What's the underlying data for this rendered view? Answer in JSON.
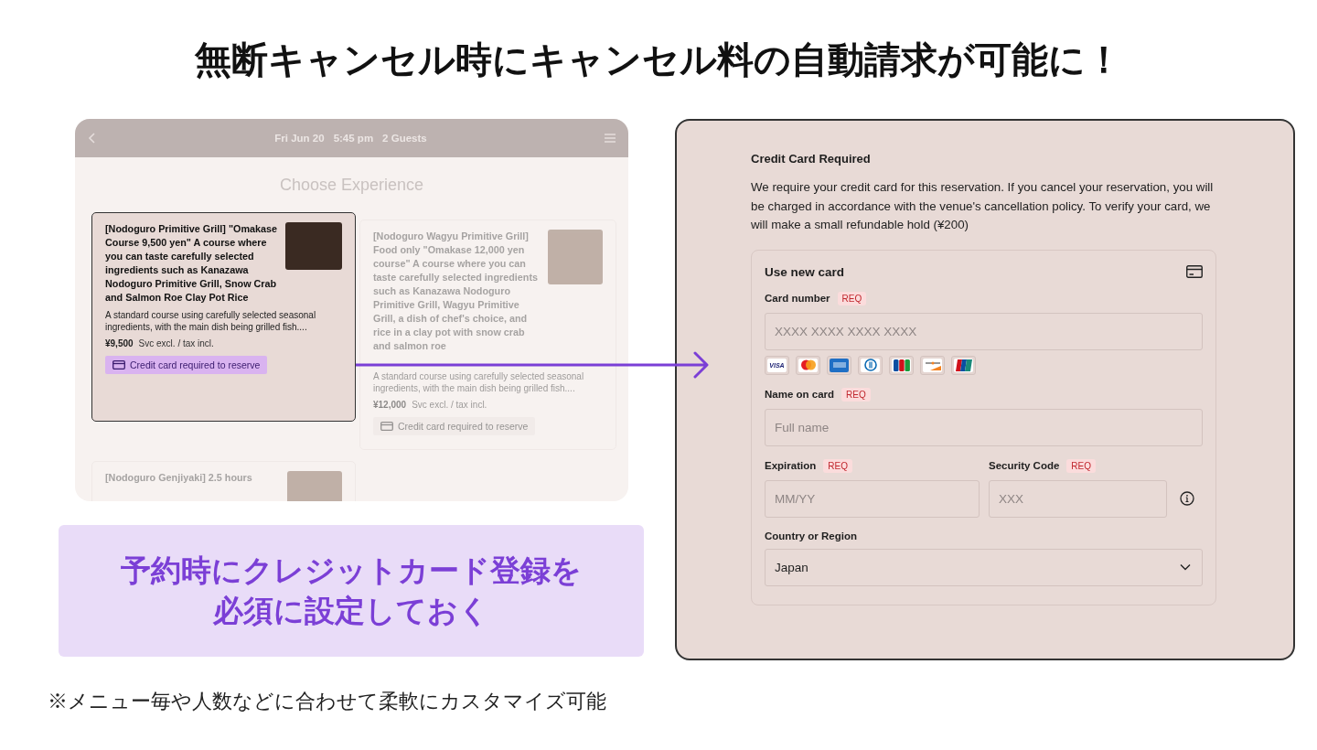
{
  "headline": "無断キャンセル時にキャンセル料の自動請求が可能に！",
  "app": {
    "header": [
      "Fri Jun 20",
      "5:45 pm",
      "2 Guests"
    ],
    "heading": "Choose Experience",
    "cards": [
      {
        "highlighted": true,
        "title": "[Nodoguro Primitive Grill] \"Omakase Course 9,500 yen\" A course where you can taste carefully selected ingredients such as Kanazawa Nodoguro Primitive Grill, Snow Crab and Salmon Roe Clay Pot Rice",
        "description": "A standard course using carefully selected seasonal ingredients, with the main dish being grilled fish....",
        "price": "¥9,500",
        "price_note": "Svc excl. / tax incl.",
        "badge": "Credit card required to reserve"
      },
      {
        "highlighted": false,
        "title": "[Nodoguro Wagyu Primitive Grill] Food only \"Omakase 12,000 yen course\" A course where you can taste carefully selected ingredients such as Kanazawa Nodoguro Primitive Grill, Wagyu Primitive Grill, a dish of chef's choice, and rice in a clay pot with snow crab and salmon roe",
        "description": "A standard course using carefully selected seasonal ingredients, with the main dish being grilled fish....",
        "price": "¥12,000",
        "price_note": "Svc excl. / tax incl.",
        "badge": "Credit card required to reserve"
      },
      {
        "highlighted": false,
        "title": "[Nodoguro Genjiyaki] 2.5 hours"
      }
    ]
  },
  "callout": "予約時にクレジットカード登録を必須に設定しておく",
  "footnote": "※メニュー毎や人数などに合わせて柔軟にカスタマイズ可能",
  "payment": {
    "title": "Credit Card Required",
    "text": "We require your credit card for this reservation. If you cancel your reservation, you will be charged in accordance with the venue's cancellation policy. To verify your card, we will make a small refundable hold (¥200)",
    "card_title": "Use new card",
    "card_number": {
      "label": "Card number",
      "badge": "REQ",
      "placeholder": "XXXX XXXX XXXX XXXX"
    },
    "brands": [
      {
        "kind": "visa",
        "label": "VISA"
      },
      {
        "kind": "mastercard"
      },
      {
        "kind": "amex"
      },
      {
        "kind": "diners"
      },
      {
        "kind": "jcb"
      },
      {
        "kind": "discover"
      },
      {
        "kind": "unionpay"
      }
    ],
    "name": {
      "label": "Name on card",
      "badge": "REQ",
      "placeholder": "Full name"
    },
    "expiration": {
      "label": "Expiration",
      "badge": "REQ",
      "placeholder": "MM/YY"
    },
    "security": {
      "label": "Security Code",
      "badge": "REQ",
      "placeholder": "XXX"
    },
    "country": {
      "label": "Country or Region",
      "value": "Japan"
    }
  }
}
